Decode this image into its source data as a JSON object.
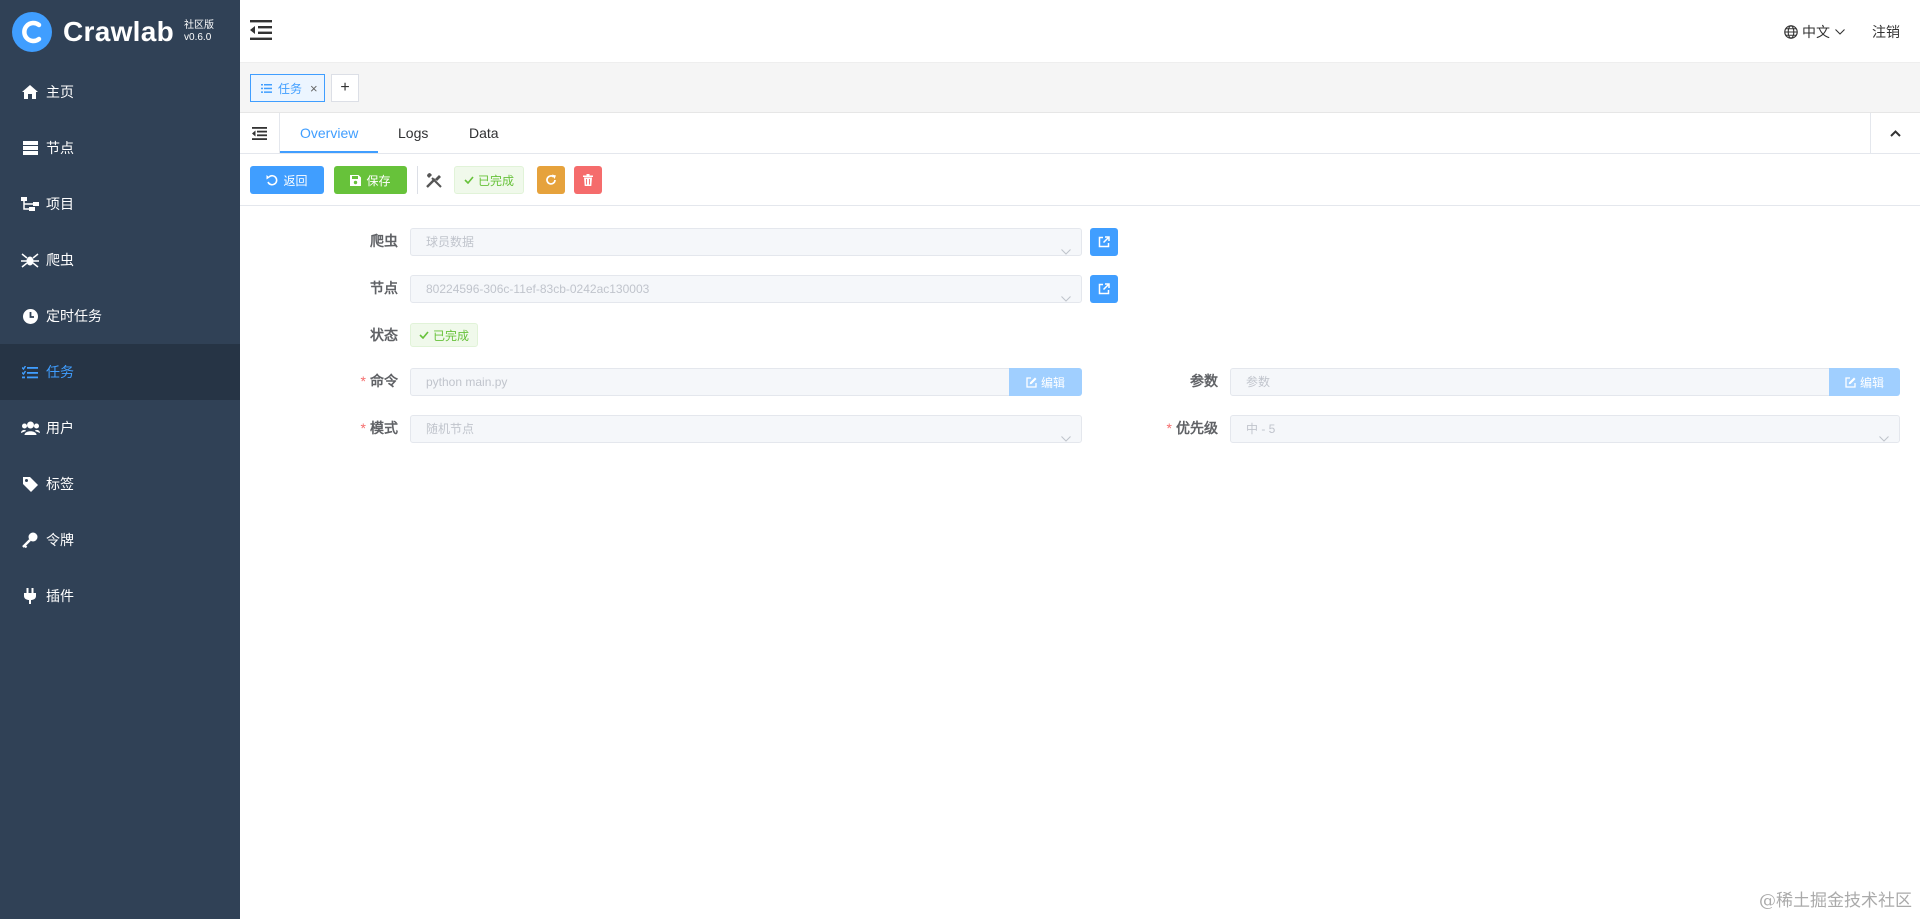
{
  "app": {
    "name": "Crawlab",
    "edition": "社区版",
    "version": "v0.6.0"
  },
  "sidebar": {
    "items": [
      {
        "label": "主页",
        "icon": "home-icon"
      },
      {
        "label": "节点",
        "icon": "server-icon"
      },
      {
        "label": "项目",
        "icon": "project-tree-icon"
      },
      {
        "label": "爬虫",
        "icon": "spider-icon"
      },
      {
        "label": "定时任务",
        "icon": "clock-icon"
      },
      {
        "label": "任务",
        "icon": "task-list-icon",
        "active": true
      },
      {
        "label": "用户",
        "icon": "users-icon"
      },
      {
        "label": "标签",
        "icon": "tag-icon"
      },
      {
        "label": "令牌",
        "icon": "key-icon"
      },
      {
        "label": "插件",
        "icon": "plug-icon"
      }
    ]
  },
  "header": {
    "language": "中文",
    "logout": "注销"
  },
  "tabs_bar": {
    "tab_label": "任务",
    "add_label": "+"
  },
  "nav_tabs": [
    "Overview",
    "Logs",
    "Data"
  ],
  "actions": {
    "back_label": "返回",
    "save_label": "保存",
    "status_label": "已完成"
  },
  "form": {
    "spider": {
      "label": "爬虫",
      "value": "球员数据"
    },
    "node": {
      "label": "节点",
      "value": "80224596-306c-11ef-83cb-0242ac130003"
    },
    "status": {
      "label": "状态",
      "value": "已完成"
    },
    "command": {
      "label": "命令",
      "value": "python main.py",
      "edit_label": "编辑"
    },
    "params": {
      "label": "参数",
      "placeholder": "参数",
      "edit_label": "编辑"
    },
    "mode": {
      "label": "模式",
      "value": "随机节点"
    },
    "priority": {
      "label": "优先级",
      "value": "中 - 5"
    }
  },
  "watermark": "@稀土掘金技术社区",
  "colors": {
    "sidebar_bg": "#304156",
    "sidebar_active_bg": "#263445",
    "primary": "#409eff",
    "success": "#67c23a",
    "warning": "#e6a23c",
    "danger": "#f56c6c"
  }
}
